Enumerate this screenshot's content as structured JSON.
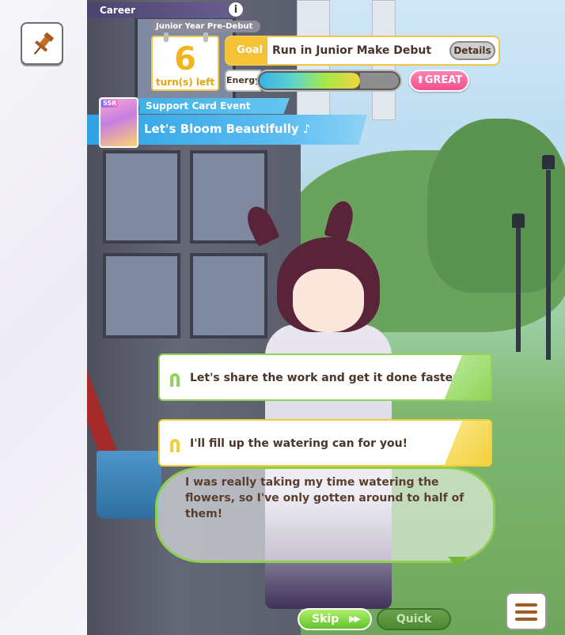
{
  "header": {
    "career_label": "Career",
    "info_icon": "i",
    "year_label": "Junior Year Pre-Debut",
    "turns_number": "6",
    "turns_label": "turn(s) left"
  },
  "goal": {
    "label": "Goal",
    "text": "Run in Junior Make Debut",
    "details_label": "Details"
  },
  "energy": {
    "label": "Energy",
    "level_fraction": 0.72
  },
  "mood": {
    "label": "GREAT",
    "color": "#f2508d"
  },
  "event": {
    "type_label": "Support Card Event",
    "title": "Let's Bloom Beautifully ♪",
    "card_rarity": "SSR"
  },
  "choices": [
    {
      "text": "Let's share the work and get it done faster!",
      "color": "#8fd456",
      "icon": "horseshoe-icon"
    },
    {
      "text": "I'll fill up the watering can for you!",
      "color": "#f3cf37",
      "icon": "horseshoe-icon"
    }
  ],
  "dialogue": {
    "text": "I was really taking my time watering the flowers, so I've only gotten around to half of them!"
  },
  "controls": {
    "skip_label": "Skip",
    "skip_arrows": "▶▶",
    "quick_label": "Quick",
    "menu_icon": "hamburger-menu-icon",
    "pin_icon": "pushpin-icon"
  }
}
